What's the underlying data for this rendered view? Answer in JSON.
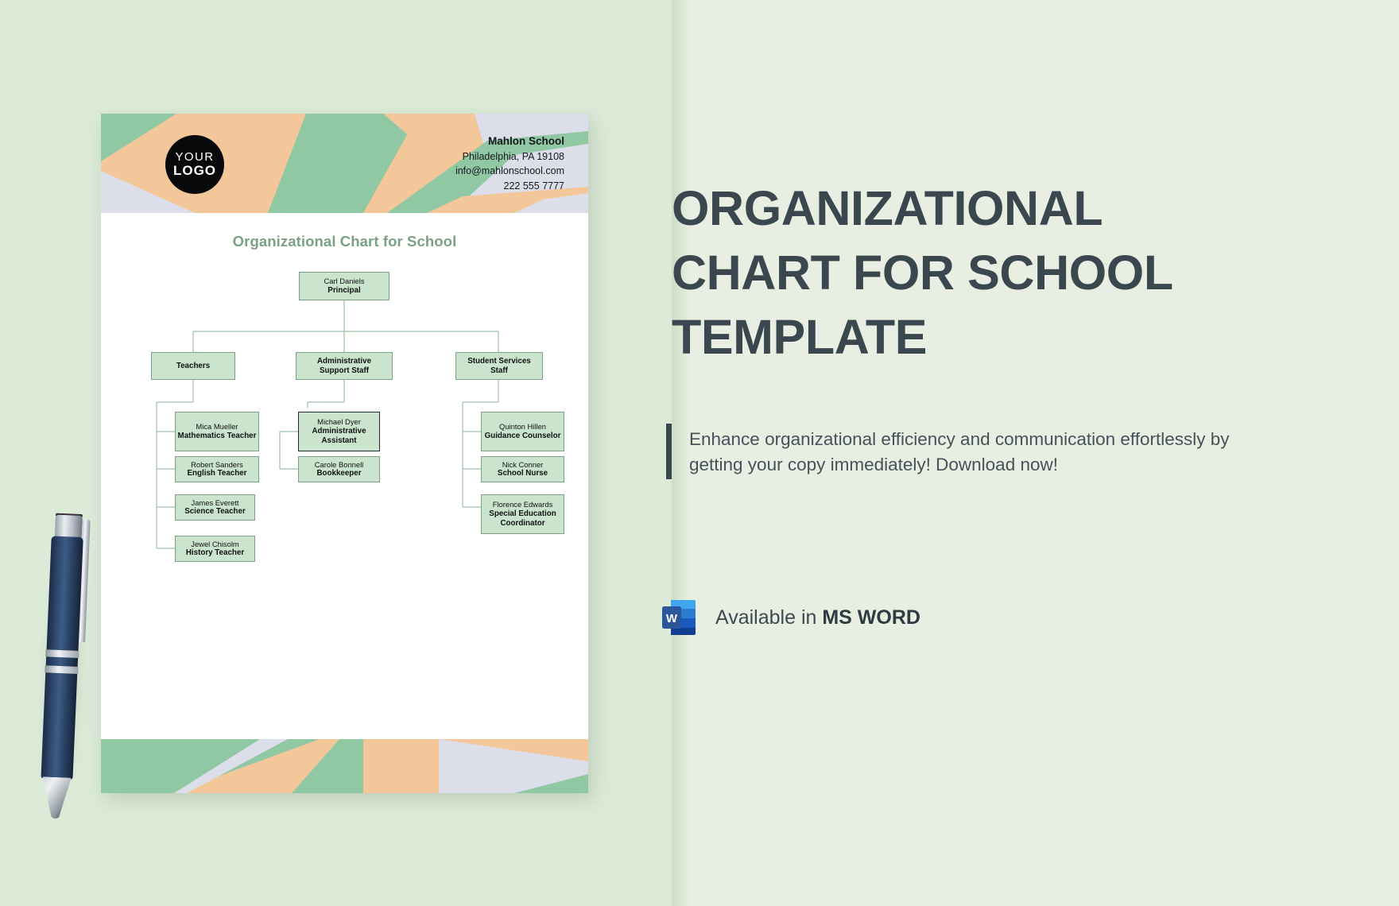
{
  "theme": {
    "page_bg": "#dcebd8",
    "right_bg": "#e8eee2",
    "accent_green": "#91c8a4",
    "accent_peach": "#f4c79a",
    "accent_lilac": "#dcdeea",
    "title_green": "#7aa086",
    "node_fill": "#cbe4cd",
    "node_border": "#7d9f84",
    "heading_dark": "#3b474e"
  },
  "document": {
    "logo": {
      "line1": "YOUR",
      "line2": "LOGO"
    },
    "contact": {
      "name": "Mahlon School",
      "address": "Philadelphia, PA 19108",
      "email": "info@mahlonschool.com",
      "phone": "222 555 7777"
    },
    "chart_title": "Organizational Chart for School"
  },
  "chart_data": {
    "type": "diagram",
    "title": "Organizational Chart for School",
    "orientation": "top-down",
    "nodes": [
      {
        "id": "principal",
        "name": "Carl Daniels",
        "role": "Principal",
        "level": 1,
        "parent": null,
        "highlight": false
      },
      {
        "id": "teachers",
        "name": "",
        "role": "Teachers",
        "level": 2,
        "parent": "principal",
        "highlight": false
      },
      {
        "id": "admin-support",
        "name": "",
        "role": "Administrative Support Staff",
        "level": 2,
        "parent": "principal",
        "highlight": false
      },
      {
        "id": "student-services",
        "name": "",
        "role": "Student Services Staff",
        "level": 2,
        "parent": "principal",
        "highlight": false
      },
      {
        "id": "math-teacher",
        "name": "Mica Mueller",
        "role": "Mathematics Teacher",
        "level": 3,
        "parent": "teachers",
        "highlight": false
      },
      {
        "id": "english-teacher",
        "name": "Robert Sanders",
        "role": "English Teacher",
        "level": 3,
        "parent": "teachers",
        "highlight": false
      },
      {
        "id": "science-teacher",
        "name": "James Everett",
        "role": "Science Teacher",
        "level": 3,
        "parent": "teachers",
        "highlight": false
      },
      {
        "id": "history-teacher",
        "name": "Jewel Chisolm",
        "role": "History Teacher",
        "level": 3,
        "parent": "teachers",
        "highlight": false
      },
      {
        "id": "admin-assistant",
        "name": "Michael Dyer",
        "role": "Administrative Assistant",
        "level": 3,
        "parent": "admin-support",
        "highlight": true
      },
      {
        "id": "bookkeeper",
        "name": "Carole Bonnell",
        "role": "Bookkeeper",
        "level": 3,
        "parent": "admin-support",
        "highlight": false
      },
      {
        "id": "guidance-counselor",
        "name": "Quinton Hillen",
        "role": "Guidance Counselor",
        "level": 3,
        "parent": "student-services",
        "highlight": false
      },
      {
        "id": "school-nurse",
        "name": "Nick Conner",
        "role": "School Nurse",
        "level": 3,
        "parent": "student-services",
        "highlight": false
      },
      {
        "id": "sped-coordinator",
        "name": "Florence Edwards",
        "role": "Special Education Coordinator",
        "level": 3,
        "parent": "student-services",
        "highlight": false
      }
    ]
  },
  "promo": {
    "headline_lines": [
      "ORGANIZATIONAL",
      "CHART FOR SCHOOL",
      "TEMPLATE"
    ],
    "headline": "ORGANIZATIONAL CHART FOR SCHOOL TEMPLATE",
    "tagline": "Enhance organizational efficiency and communication effortlessly by getting your copy immediately! Download now!",
    "availability_prefix": "Available in ",
    "availability_format": "MS WORD",
    "word_icon_letter": "W",
    "icon_name": "ms-word-icon"
  }
}
